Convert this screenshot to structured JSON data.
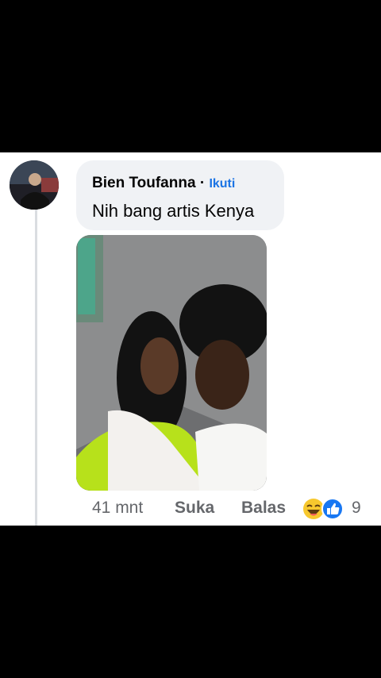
{
  "comment": {
    "author": "Bien Toufanna",
    "separator": "·",
    "follow_label": "Ikuti",
    "text": "Nih bang artis Kenya",
    "timestamp": "41 mnt",
    "like_label": "Suka",
    "reply_label": "Balas",
    "reaction_count": "9",
    "reaction_icons": [
      "laughing-emoji-icon",
      "like-thumb-icon"
    ]
  },
  "colors": {
    "accent": "#1b74e4",
    "bubble": "#f0f2f5",
    "meta_text": "#65676b"
  }
}
